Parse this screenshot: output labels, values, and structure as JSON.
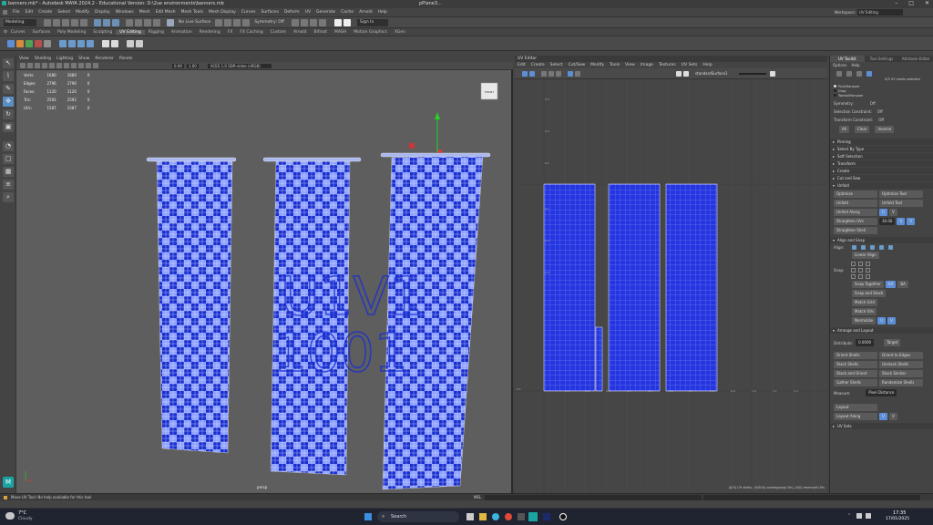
{
  "window": {
    "title": "banners.mb* - Autodesk MAYA 2024.2 - Educational Version: D:\\2ue environments\\banners.mb",
    "tab_title": "pPlane3..."
  },
  "menubar": {
    "items": [
      "File",
      "Edit",
      "Create",
      "Select",
      "Modify",
      "Display",
      "Windows",
      "Mesh",
      "Edit Mesh",
      "Mesh Tools",
      "Mesh Display",
      "Curves",
      "Surfaces",
      "Deform",
      "UV",
      "Generate",
      "Cache",
      "Arnold",
      "Help"
    ],
    "workspace_label": "Workspace:",
    "workspace_value": "UV Editing"
  },
  "toolbar": {
    "mode": "Modeling",
    "no_live_surface": "No Live Surface",
    "symmetry": "Symmetry: Off",
    "sign_in": "Sign In"
  },
  "shelf": {
    "tabs": [
      "Curves",
      "Surfaces",
      "Poly Modeling",
      "Sculpting",
      "UV Editing",
      "Rigging",
      "Animation",
      "Rendering",
      "FX",
      "FX Caching",
      "Custom",
      "Arnold",
      "Bifrost",
      "MASH",
      "Motion Graphics",
      "XGen"
    ],
    "active": "UV Editing"
  },
  "viewport": {
    "menu": [
      "View",
      "Shading",
      "Lighting",
      "Show",
      "Renderer",
      "Panels"
    ],
    "fields": {
      "near": "0.00",
      "far": "1.00",
      "colorspace": "ACES 1.0 SDR-video (sRGB)"
    },
    "hud": [
      {
        "label": "Verts:",
        "a": "1680",
        "b": "1680",
        "c": "0"
      },
      {
        "label": "Edges:",
        "a": "2796",
        "b": "2796",
        "c": "0"
      },
      {
        "label": "Faces:",
        "a": "1120",
        "b": "1120",
        "c": "0"
      },
      {
        "label": "Tris:",
        "a": "2592",
        "b": "2592",
        "c": "0"
      },
      {
        "label": "UVs:",
        "a": "1587",
        "b": "1587",
        "c": "0"
      }
    ],
    "cam_label": "persp",
    "viewcube": "FRONT",
    "banner_text_1": "U1V1",
    "banner_text_2": "1001",
    "colors": {
      "checker_dark": "#1a2fd0",
      "checker_light": "#8da0ff",
      "bg": "#5e5e5e"
    }
  },
  "uv_editor": {
    "title": "UV Editor",
    "menu": [
      "Edit",
      "Create",
      "Select",
      "Cut/Sew",
      "Modify",
      "Tools",
      "View",
      "Image",
      "Textures",
      "UV Sets",
      "Help"
    ],
    "texture": "standardSurface1",
    "ticks_left": [
      "0.3",
      "0.2",
      "0.1",
      "0.1",
      "0.2",
      "0.3"
    ],
    "tick_origin": "0.1",
    "ticks_bottom": [
      "0.1",
      "0.2",
      "0.3",
      "0.4",
      "0.5",
      "0.6",
      "0.7",
      "0.8",
      "0.9",
      "1.0",
      "1.1",
      "1.2"
    ],
    "status": "(0/3) UV shells, (0/504) overlapping UVs, (0/0) reversed UVs"
  },
  "right_panel": {
    "tabs": [
      "UV Toolkit",
      "Tool Settings",
      "Attribute Editor"
    ],
    "options": [
      "Options",
      "Help"
    ],
    "shells_selected": "0/3 UV shells selected",
    "pick_modes": [
      "Pick/Marquee",
      "Drag",
      "Tweak/Marquee"
    ],
    "symmetry_label": "Symmetry:",
    "symmetry_value": "Off",
    "selection_constraint": "Selection Constraint:",
    "sel_value": "Off",
    "transform_constraint": "Transform Constraint:",
    "tr_value": "Off",
    "buttons_all": [
      "All",
      "Clear",
      "Inverse"
    ],
    "sections": [
      "Pinning",
      "Select By Type",
      "Soft Selection",
      "Transform",
      "Create",
      "Cut and Sew",
      "Unfold"
    ],
    "unfold": {
      "optimize": "Optimize",
      "optimize_tool": "Optimize Tool",
      "unfold": "Unfold",
      "unfold_tool": "Unfold Tool",
      "unfold_along": "Unfold Along",
      "u": "U",
      "v": "V",
      "straighten_uvs": "Straighten UVs",
      "angle": "30.00",
      "straighten_shell": "Straighten Shell"
    },
    "align_snap": {
      "title": "Align and Snap",
      "align": "Align:",
      "linear_align": "Linear Align",
      "snap": "Snap:",
      "snap_together": "Snap Together",
      "snap_and_stack": "Snap and Stack",
      "match_grid": "Match Grid",
      "match_uvs": "Match UVs",
      "normalize": "Normalize",
      "aa": "AA",
      "ba": "BA"
    },
    "arrange": {
      "title": "Arrange and Layout",
      "distribute": "Distribute:",
      "distribute_value": "0.0000",
      "target": "Target",
      "orient_shells": "Orient Shells",
      "orient_to_edges": "Orient to Edges",
      "stack_shells": "Stack Shells",
      "unstack_shells": "Unstack Shells",
      "stack_orient": "Stack and Orient",
      "stack_similar": "Stack Similar",
      "gather_shells": "Gather Shells",
      "randomize_shells": "Randomize Shells",
      "measure": "Measure:",
      "measure_value": "Pixel Distance",
      "layout": "Layout",
      "layout_along": "Layout Along"
    },
    "uv_sets": "UV Sets"
  },
  "status_bar": {
    "message": "Move UV Tool: No help available for this tool",
    "mel": "MEL"
  },
  "taskbar": {
    "weather_temp": "7°C",
    "weather_desc": "Cloudy",
    "search": "Search",
    "time": "17:35",
    "date": "17/01/2025"
  }
}
